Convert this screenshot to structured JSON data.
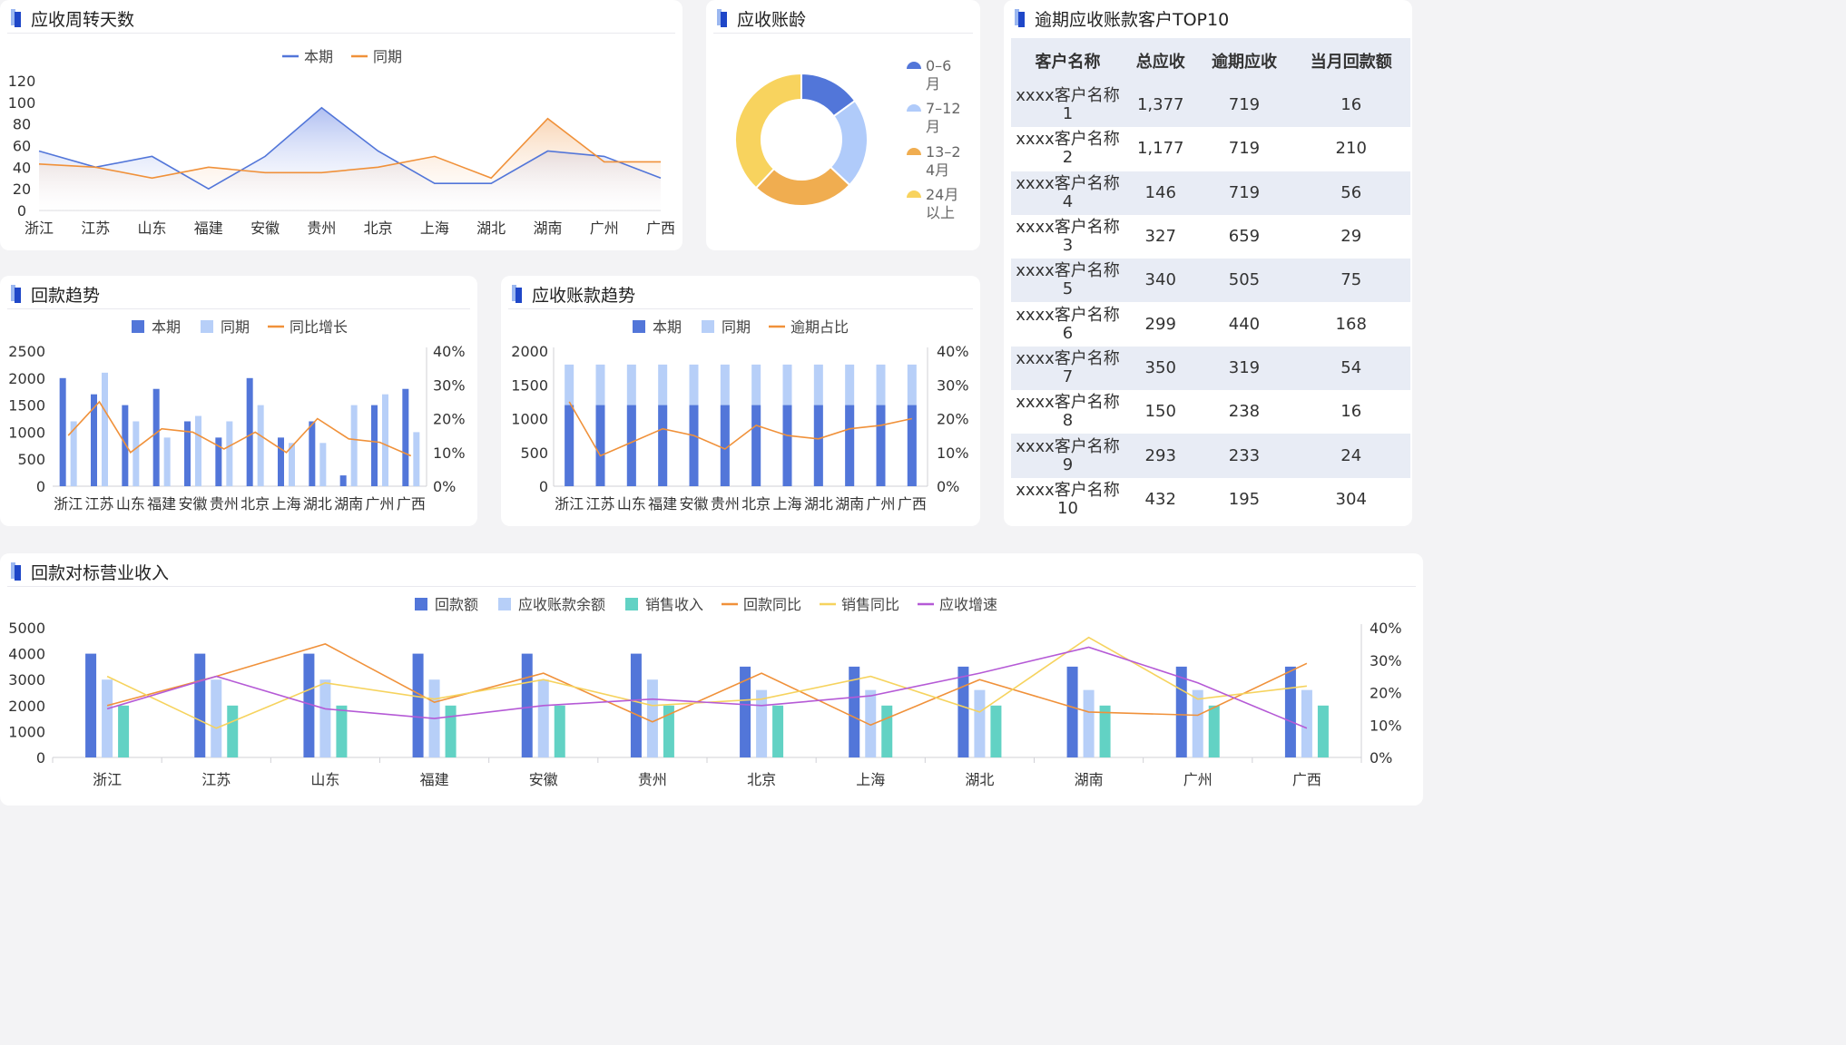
{
  "colors": {
    "current": "#5276d9",
    "previous": "#b7cff8",
    "orange": "#f0913a",
    "teal": "#62d2c4",
    "yellow": "#f6d35e",
    "purple": "#b55ad6",
    "donut": [
      "#5276d9",
      "#b0cbfa",
      "#f0ad50",
      "#f8d35e"
    ]
  },
  "panels": {
    "turnover": {
      "title": "应收周转天数"
    },
    "aging": {
      "title": "应收账龄"
    },
    "top10": {
      "title": "逾期应收账款客户TOP10"
    },
    "repay": {
      "title": "回款趋势"
    },
    "ar": {
      "title": "应收账款趋势"
    },
    "bench": {
      "title": "回款对标营业收入"
    }
  },
  "table": {
    "headers": [
      "客户名称",
      "总应收",
      "逾期应收",
      "当月回款额"
    ],
    "rows": [
      [
        "xxxx客户名称1",
        "1,377",
        "719",
        "16"
      ],
      [
        "xxxx客户名称2",
        "1,177",
        "719",
        "210"
      ],
      [
        "xxxx客户名称4",
        "146",
        "719",
        "56"
      ],
      [
        "xxxx客户名称3",
        "327",
        "659",
        "29"
      ],
      [
        "xxxx客户名称5",
        "340",
        "505",
        "75"
      ],
      [
        "xxxx客户名称6",
        "299",
        "440",
        "168"
      ],
      [
        "xxxx客户名称7",
        "350",
        "319",
        "54"
      ],
      [
        "xxxx客户名称8",
        "150",
        "238",
        "16"
      ],
      [
        "xxxx客户名称9",
        "293",
        "233",
        "24"
      ],
      [
        "xxxx客户名称10",
        "432",
        "195",
        "304"
      ]
    ]
  },
  "chart_data": [
    {
      "id": "turnover",
      "type": "area",
      "categories": [
        "浙江",
        "江苏",
        "山东",
        "福建",
        "安徽",
        "贵州",
        "北京",
        "上海",
        "湖北",
        "湖南",
        "广州",
        "广西"
      ],
      "series": [
        {
          "name": "本期",
          "values": [
            55,
            40,
            50,
            20,
            50,
            95,
            55,
            25,
            25,
            55,
            50,
            30
          ]
        },
        {
          "name": "同期",
          "values": [
            43,
            40,
            30,
            40,
            35,
            35,
            40,
            50,
            30,
            85,
            45,
            45
          ]
        }
      ],
      "yticks": [
        "0",
        "20",
        "40",
        "60",
        "80",
        "100",
        "120"
      ],
      "ylim": [
        0,
        120
      ]
    },
    {
      "id": "aging",
      "type": "pie",
      "labels": [
        "0-6月",
        "7-12月",
        "13-24月",
        "24月以上"
      ],
      "values": [
        15,
        22,
        25,
        38
      ]
    },
    {
      "id": "repay",
      "type": "bar",
      "categories": [
        "浙江",
        "江苏",
        "山东",
        "福建",
        "安徽",
        "贵州",
        "北京",
        "上海",
        "湖北",
        "湖南",
        "广州",
        "广西"
      ],
      "series": [
        {
          "name": "本期",
          "values": [
            2000,
            1700,
            1500,
            1800,
            1200,
            900,
            2000,
            900,
            1200,
            200,
            1500,
            1800
          ]
        },
        {
          "name": "同期",
          "values": [
            1200,
            2100,
            1200,
            900,
            1300,
            1200,
            1500,
            800,
            800,
            1500,
            1700,
            1000
          ]
        },
        {
          "name": "同比增长",
          "axis": "right",
          "values": [
            15,
            25,
            10,
            17,
            16,
            11,
            16,
            10,
            20,
            14,
            13,
            9
          ]
        }
      ],
      "yticks_left": [
        "0",
        "500",
        "1000",
        "1500",
        "2000",
        "2500"
      ],
      "ylim_left": [
        0,
        2500
      ],
      "yticks_right": [
        "0%",
        "10%",
        "20%",
        "30%",
        "40%"
      ],
      "ylim_right": [
        0,
        40
      ]
    },
    {
      "id": "ar",
      "type": "bar",
      "categories": [
        "浙江",
        "江苏",
        "山东",
        "福建",
        "安徽",
        "贵州",
        "北京",
        "上海",
        "湖北",
        "湖南",
        "广州",
        "广西"
      ],
      "series": [
        {
          "name": "本期",
          "values": [
            1200,
            1200,
            1200,
            1200,
            1200,
            1200,
            1200,
            1200,
            1200,
            1200,
            1200,
            1200
          ]
        },
        {
          "name": "同期",
          "values": [
            1800,
            1800,
            1800,
            1800,
            1800,
            1800,
            1800,
            1800,
            1800,
            1800,
            1800,
            1800
          ]
        },
        {
          "name": "逾期占比",
          "axis": "right",
          "values": [
            25,
            9,
            13,
            17,
            15,
            11,
            18,
            15,
            14,
            17,
            18,
            20
          ]
        }
      ],
      "yticks_left": [
        "0",
        "500",
        "1000",
        "1500",
        "2000"
      ],
      "ylim_left": [
        0,
        2000
      ],
      "yticks_right": [
        "0%",
        "10%",
        "20%",
        "30%",
        "40%"
      ],
      "ylim_right": [
        0,
        40
      ]
    },
    {
      "id": "bench",
      "type": "bar",
      "categories": [
        "浙江",
        "江苏",
        "山东",
        "福建",
        "安徽",
        "贵州",
        "北京",
        "上海",
        "湖北",
        "湖南",
        "广州",
        "广西"
      ],
      "series": [
        {
          "name": "回款额",
          "values": [
            4000,
            4000,
            4000,
            4000,
            4000,
            4000,
            3500,
            3500,
            3500,
            3500,
            3500,
            3500
          ]
        },
        {
          "name": "应收账款余额",
          "values": [
            3000,
            3000,
            3000,
            3000,
            3000,
            3000,
            2600,
            2600,
            2600,
            2600,
            2600,
            2600
          ]
        },
        {
          "name": "销售收入",
          "values": [
            2000,
            2000,
            2000,
            2000,
            2000,
            2000,
            2000,
            2000,
            2000,
            2000,
            2000,
            2000
          ]
        },
        {
          "name": "回款同比",
          "axis": "right",
          "values": [
            16,
            25,
            35,
            17,
            26,
            11,
            26,
            10,
            24,
            14,
            13,
            29
          ]
        },
        {
          "name": "销售同比",
          "axis": "right",
          "values": [
            25,
            9,
            23,
            18,
            24,
            16,
            18,
            25,
            14,
            37,
            18,
            22
          ]
        },
        {
          "name": "应收增速",
          "axis": "right",
          "values": [
            15,
            25,
            15,
            12,
            16,
            18,
            16,
            19,
            26,
            34,
            23,
            9
          ]
        }
      ],
      "yticks_left": [
        "0",
        "1000",
        "2000",
        "3000",
        "4000",
        "5000"
      ],
      "ylim_left": [
        0,
        5000
      ],
      "yticks_right": [
        "0%",
        "10%",
        "20%",
        "30%",
        "40%"
      ],
      "ylim_right": [
        0,
        40
      ]
    }
  ]
}
